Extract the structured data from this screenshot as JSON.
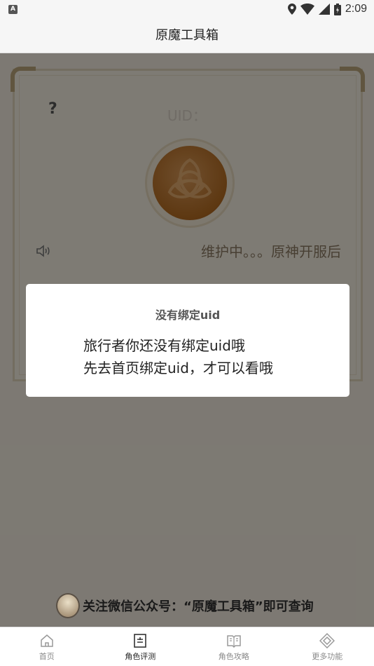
{
  "status_bar": {
    "left_badge": "A",
    "time": "2:09",
    "icons": [
      "location-icon",
      "wifi-icon",
      "signal-icon",
      "battery-icon"
    ]
  },
  "app_bar": {
    "title": "原魔工具箱"
  },
  "card": {
    "help_label": "?",
    "uid_label": "UID：",
    "notice_text": "维护中。。。原神开服后"
  },
  "dialog": {
    "title": "没有绑定uid",
    "message_line1": "旅行者你还没有绑定uid哦",
    "message_line2": "先去首页绑定uid，才可以看哦"
  },
  "footer": {
    "follow_text": "关注微信公众号：“原魔工具箱”即可查询"
  },
  "tabs": [
    {
      "label": "首页",
      "icon": "home-icon",
      "active": false
    },
    {
      "label": "角色评测",
      "icon": "evaluation-icon",
      "active": true
    },
    {
      "label": "角色攻略",
      "icon": "book-icon",
      "active": false
    },
    {
      "label": "更多功能",
      "icon": "diamond-icon",
      "active": false
    }
  ],
  "colors": {
    "overlay": "#000000",
    "card_border": "#ddd2b8",
    "avatar": "#b36b22"
  }
}
